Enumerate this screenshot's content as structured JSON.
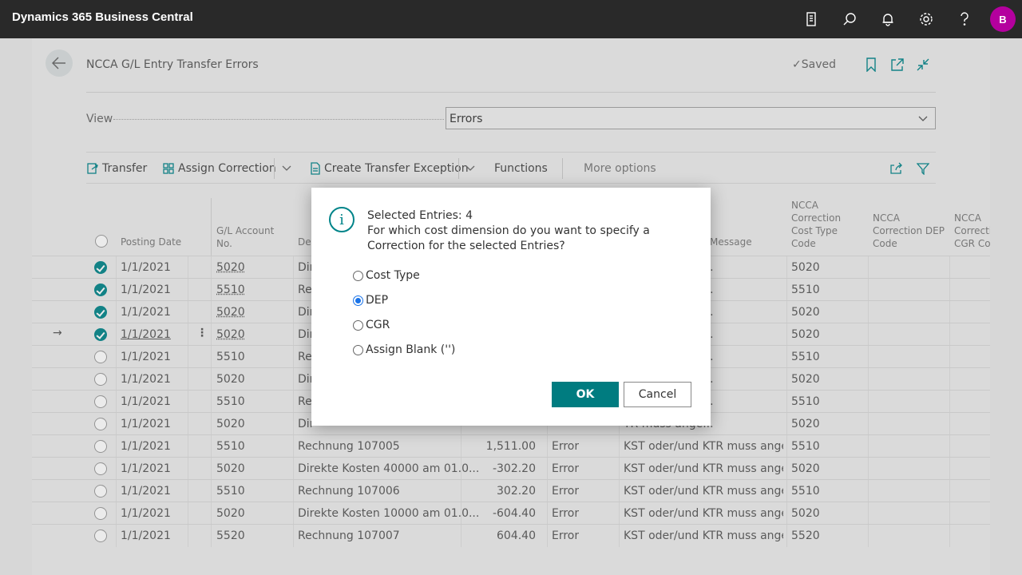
{
  "app": {
    "title": "Dynamics 365 Business Central",
    "avatar_initial": "B"
  },
  "topbar_icons": [
    "document-icon",
    "search-icon",
    "bell-icon",
    "gear-icon",
    "help-icon"
  ],
  "page": {
    "title": "NCCA G/L Entry Transfer Errors",
    "saved_label": "Saved",
    "view_label": "View",
    "view_value": "Errors"
  },
  "actions": {
    "transfer": "Transfer",
    "assign_correction": "Assign Correction",
    "create_transfer_exception": "Create Transfer Exception",
    "functions": "Functions",
    "more_options": "More options"
  },
  "columns": {
    "posting_date": "Posting Date",
    "gl_account_1": "G/L Account",
    "gl_account_2": "No.",
    "description": "Des",
    "message": "Message",
    "cost_type_1": "NCCA",
    "cost_type_2": "Correction",
    "cost_type_3": "Cost Type",
    "cost_type_4": "Code",
    "dep_1": "NCCA",
    "dep_2": "Correction DEP",
    "dep_3": "Code",
    "cgr_1": "NCCA",
    "cgr_2": "Correctio",
    "cgr_3": "CGR Coc"
  },
  "rows": [
    {
      "date": "1/1/2021",
      "account": "5020",
      "desc": "Dir",
      "amount": "",
      "type": "",
      "message": "TR muss ange...",
      "cost_type": "5020",
      "selected": true
    },
    {
      "date": "1/1/2021",
      "account": "5510",
      "desc": "Re",
      "amount": "",
      "type": "",
      "message": "TR muss ange...",
      "cost_type": "5510",
      "selected": true
    },
    {
      "date": "1/1/2021",
      "account": "5020",
      "desc": "Dir",
      "amount": "",
      "type": "",
      "message": "TR muss ange...",
      "cost_type": "5020",
      "selected": true
    },
    {
      "date": "1/1/2021",
      "account": "5020",
      "desc": "Dir",
      "amount": "",
      "type": "",
      "message": "TR muss ange...",
      "cost_type": "5020",
      "selected": true
    },
    {
      "date": "1/1/2021",
      "account": "5510",
      "desc": "Re",
      "amount": "",
      "type": "",
      "message": "TR muss ange...",
      "cost_type": "5510",
      "selected": false
    },
    {
      "date": "1/1/2021",
      "account": "5020",
      "desc": "Dir",
      "amount": "",
      "type": "",
      "message": "TR muss ange...",
      "cost_type": "5020",
      "selected": false
    },
    {
      "date": "1/1/2021",
      "account": "5510",
      "desc": "Re",
      "amount": "",
      "type": "",
      "message": "TR muss ange...",
      "cost_type": "5510",
      "selected": false
    },
    {
      "date": "1/1/2021",
      "account": "5020",
      "desc": "Dir",
      "amount": "",
      "type": "",
      "message": "TR muss ange...",
      "cost_type": "5020",
      "selected": false
    },
    {
      "date": "1/1/2021",
      "account": "5510",
      "desc": "Rechnung 107005",
      "amount": "1,511.00",
      "type": "Error",
      "message": "KST oder/und KTR muss ange...",
      "cost_type": "5510",
      "selected": false
    },
    {
      "date": "1/1/2021",
      "account": "5020",
      "desc": "Direkte Kosten 40000 am 01.0...",
      "amount": "-302.20",
      "type": "Error",
      "message": "KST oder/und KTR muss ange...",
      "cost_type": "5020",
      "selected": false
    },
    {
      "date": "1/1/2021",
      "account": "5510",
      "desc": "Rechnung 107006",
      "amount": "302.20",
      "type": "Error",
      "message": "KST oder/und KTR muss ange...",
      "cost_type": "5510",
      "selected": false
    },
    {
      "date": "1/1/2021",
      "account": "5020",
      "desc": "Direkte Kosten 10000 am 01.0...",
      "amount": "-604.40",
      "type": "Error",
      "message": "KST oder/und KTR muss ange...",
      "cost_type": "5020",
      "selected": false
    },
    {
      "date": "1/1/2021",
      "account": "5520",
      "desc": "Rechnung 107007",
      "amount": "604.40",
      "type": "Error",
      "message": "KST oder/und KTR muss ange...",
      "cost_type": "5520",
      "selected": false
    }
  ],
  "dialog": {
    "line1": "Selected Entries: 4",
    "line2": "For which cost dimension do you want to specify a Correction for the selected Entries?",
    "options": [
      "Cost Type",
      "DEP",
      "CGR",
      "Assign Blank ('')"
    ],
    "selected_option": "DEP",
    "ok": "OK",
    "cancel": "Cancel"
  },
  "colors": {
    "accent": "#008489",
    "topbar": "#292929",
    "avatar": "#b4009e",
    "ok_button": "#007c80"
  }
}
